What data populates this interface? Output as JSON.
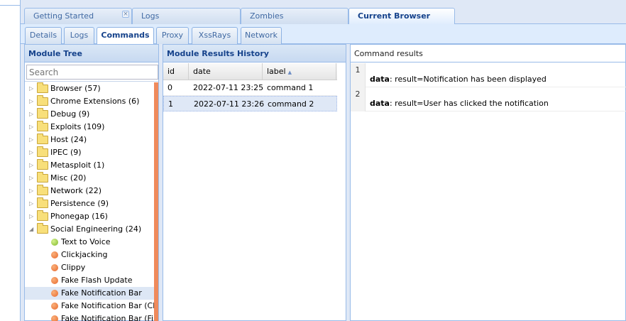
{
  "top_tabs": [
    {
      "label": "Getting Started"
    },
    {
      "label": "Logs"
    },
    {
      "label": "Zombies"
    },
    {
      "label": "Current Browser"
    }
  ],
  "sub_tabs": [
    {
      "label": "Details"
    },
    {
      "label": "Logs"
    },
    {
      "label": "Commands"
    },
    {
      "label": "Proxy"
    },
    {
      "label": "XssRays"
    },
    {
      "label": "Network"
    }
  ],
  "module_tree": {
    "title": "Module Tree",
    "search_placeholder": "Search",
    "folders": [
      "Browser (57)",
      "Chrome Extensions (6)",
      "Debug (9)",
      "Exploits (109)",
      "Host (24)",
      "IPEC (9)",
      "Metasploit (1)",
      "Misc (20)",
      "Network (22)",
      "Persistence (9)",
      "Phonegap (16)",
      "Social Engineering (24)"
    ],
    "modules": [
      {
        "label": "Text to Voice",
        "status": "green"
      },
      {
        "label": "Clickjacking",
        "status": "orange"
      },
      {
        "label": "Clippy",
        "status": "orange"
      },
      {
        "label": "Fake Flash Update",
        "status": "orange"
      },
      {
        "label": "Fake Notification Bar",
        "status": "orange"
      },
      {
        "label": "Fake Notification Bar (Chrome)",
        "status": "orange"
      },
      {
        "label": "Fake Notification Bar (Firefox)",
        "status": "orange"
      }
    ]
  },
  "history": {
    "title": "Module Results History",
    "columns": [
      "id",
      "date",
      "label"
    ],
    "rows": [
      {
        "id": "0",
        "date": "2022-07-11 23:25",
        "label": "command 1"
      },
      {
        "id": "1",
        "date": "2022-07-11 23:26",
        "label": "command 2"
      }
    ]
  },
  "results": {
    "title": "Command results",
    "rows": [
      {
        "num": "1",
        "key": "data",
        "value": ": result=Notification has been displayed"
      },
      {
        "num": "2",
        "key": "data",
        "value": ": result=User has clicked the notification"
      }
    ]
  }
}
